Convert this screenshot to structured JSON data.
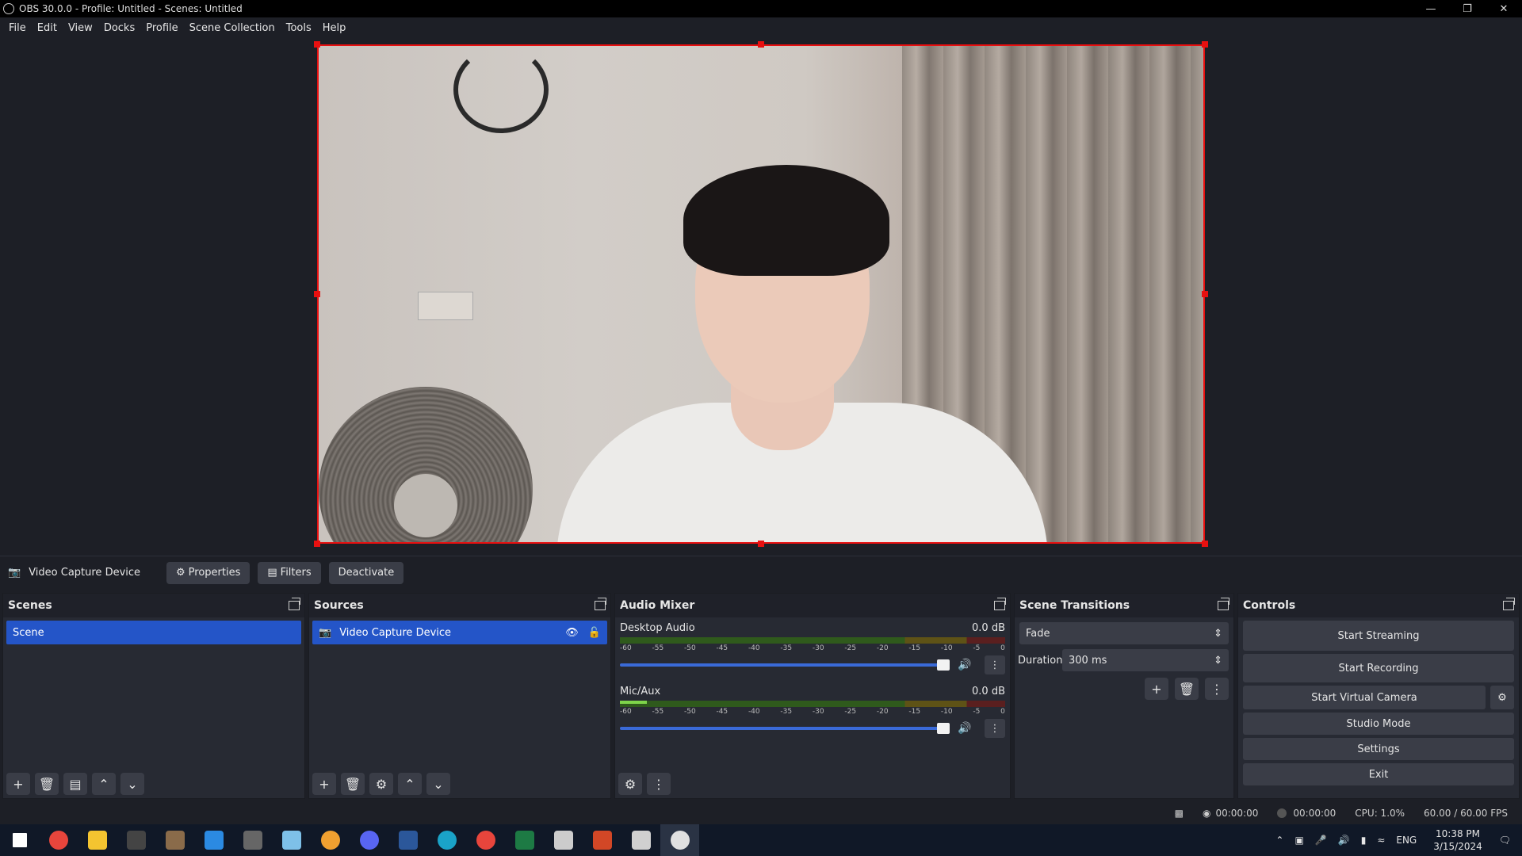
{
  "window": {
    "title": "OBS 30.0.0 - Profile: Untitled - Scenes: Untitled"
  },
  "menu": [
    "File",
    "Edit",
    "View",
    "Docks",
    "Profile",
    "Scene Collection",
    "Tools",
    "Help"
  ],
  "context_bar": {
    "source_name": "Video Capture Device",
    "properties_label": "Properties",
    "filters_label": "Filters",
    "deactivate_label": "Deactivate"
  },
  "scenes": {
    "title": "Scenes",
    "items": [
      "Scene"
    ]
  },
  "sources": {
    "title": "Sources",
    "items": [
      "Video Capture Device"
    ]
  },
  "audio_mixer": {
    "title": "Audio Mixer",
    "ticks": [
      "-60",
      "-55",
      "-50",
      "-45",
      "-40",
      "-35",
      "-30",
      "-25",
      "-20",
      "-15",
      "-10",
      "-5",
      "0"
    ],
    "channels": [
      {
        "name": "Desktop Audio",
        "db": "0.0 dB",
        "level": 0.0,
        "volume": 1.0
      },
      {
        "name": "Mic/Aux",
        "db": "0.0 dB",
        "level": 0.07,
        "volume": 1.0
      }
    ]
  },
  "scene_transitions": {
    "title": "Scene Transitions",
    "transition": "Fade",
    "duration_label": "Duration",
    "duration_value": "300 ms"
  },
  "controls": {
    "title": "Controls",
    "start_streaming": "Start Streaming",
    "start_recording": "Start Recording",
    "start_virtual_camera": "Start Virtual Camera",
    "studio_mode": "Studio Mode",
    "settings": "Settings",
    "exit": "Exit"
  },
  "status": {
    "stream_time": "00:00:00",
    "record_time": "00:00:00",
    "cpu": "CPU: 1.0%",
    "fps": "60.00 / 60.00 FPS"
  },
  "taskbar": {
    "lang": "ENG",
    "time": "10:38 PM",
    "date": "3/15/2024",
    "apps": [
      {
        "name": "start-icon",
        "color": "#ffffff"
      },
      {
        "name": "chrome-icon",
        "color": "#e8453c"
      },
      {
        "name": "file-explorer-icon",
        "color": "#f4c430"
      },
      {
        "name": "terminal-icon",
        "color": "#444444"
      },
      {
        "name": "app-icon",
        "color": "#8a6b4a"
      },
      {
        "name": "vscode-icon",
        "color": "#2b8ae2"
      },
      {
        "name": "terminal-alt-icon",
        "color": "#666666"
      },
      {
        "name": "notepad-icon",
        "color": "#7ec0e8"
      },
      {
        "name": "chrome-profile-icon",
        "color": "#f0a030"
      },
      {
        "name": "discord-icon",
        "color": "#5865f2"
      },
      {
        "name": "word-icon",
        "color": "#2b579a"
      },
      {
        "name": "edge-icon",
        "color": "#1aa3c8"
      },
      {
        "name": "chrome-alt-icon",
        "color": "#e8453c"
      },
      {
        "name": "excel-icon",
        "color": "#1d7a44"
      },
      {
        "name": "settings-icon",
        "color": "#cccccc"
      },
      {
        "name": "powerpoint-icon",
        "color": "#d24726"
      },
      {
        "name": "cloud-app-icon",
        "color": "#d0d0d0"
      },
      {
        "name": "obs-icon",
        "color": "#e0e0e0"
      }
    ]
  }
}
